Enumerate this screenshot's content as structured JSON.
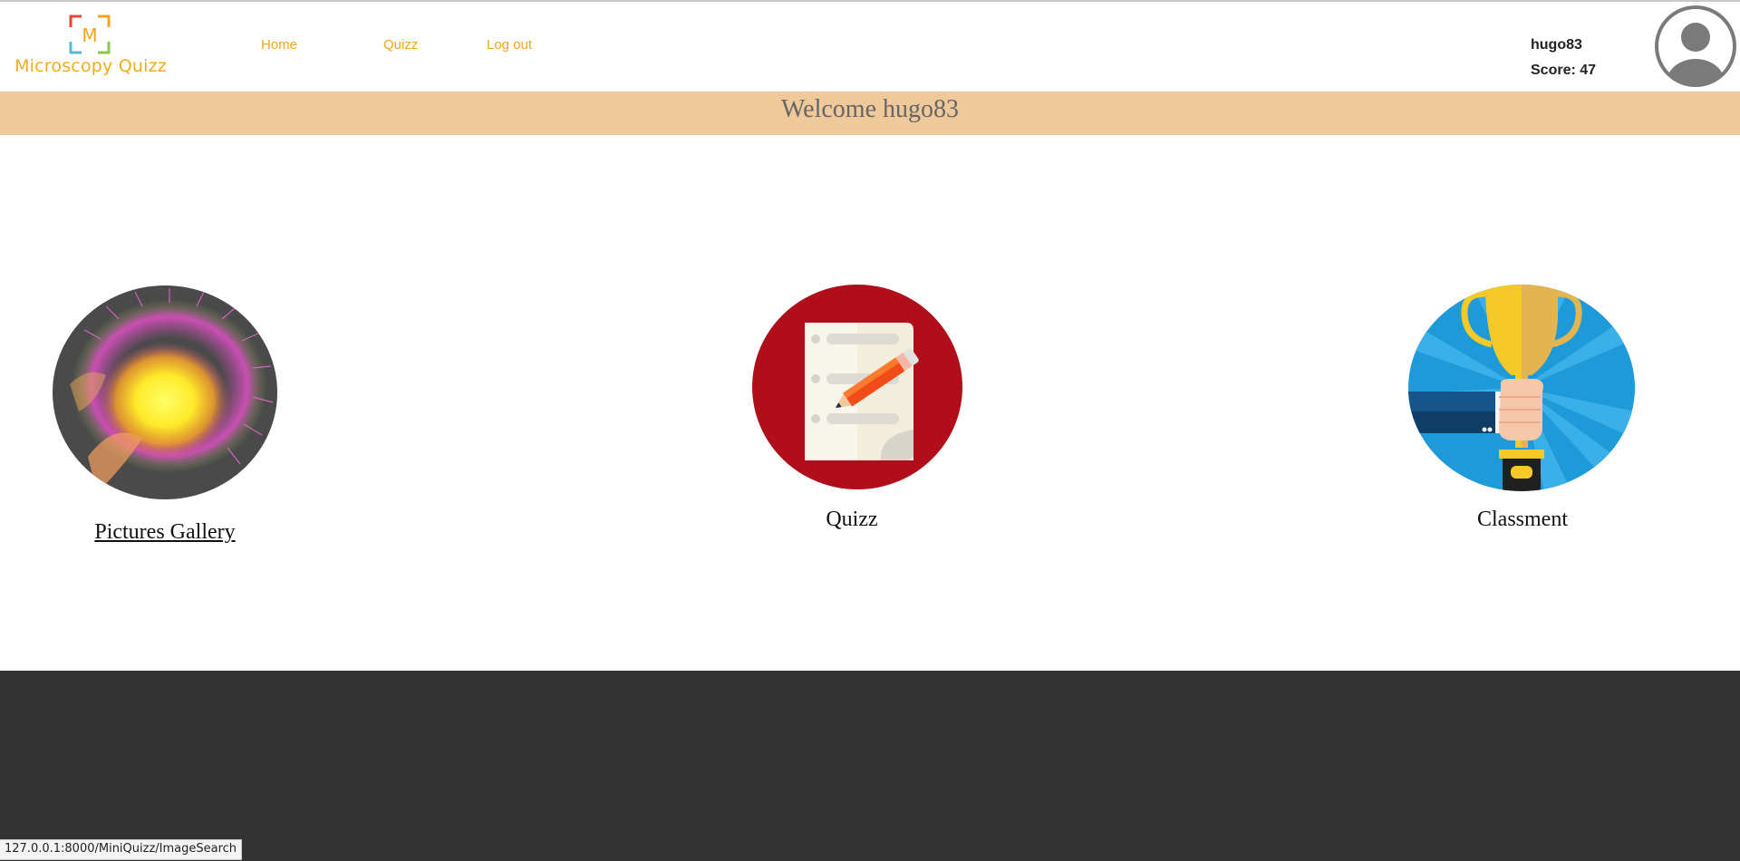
{
  "header": {
    "logo": {
      "letter": "M",
      "text": "Microscopy Quizz",
      "colors": [
        "#e9443a",
        "#f3a51b",
        "#5ab9d8",
        "#8cc84b"
      ]
    },
    "nav": [
      {
        "label": "Home"
      },
      {
        "label": "Quizz"
      },
      {
        "label": "Log out"
      }
    ],
    "nav_color": "#f0a51b",
    "user": {
      "name": "hugo83",
      "score": "Score: 47",
      "avatar_icon": "user-avatar-icon"
    }
  },
  "welcome": {
    "text": "Welcome hugo83",
    "band_color": "#efc999"
  },
  "tiles": [
    {
      "label": "Pictures Gallery",
      "icon": "microscopy-cell-image"
    },
    {
      "label": "Quizz",
      "icon": "quiz-paper-pencil-icon"
    },
    {
      "label": "Classment",
      "icon": "trophy-icon"
    }
  ],
  "footer": {
    "color": "#333333"
  },
  "status_bar": {
    "url": "127.0.0.1:8000/MiniQuizz/ImageSearch"
  }
}
